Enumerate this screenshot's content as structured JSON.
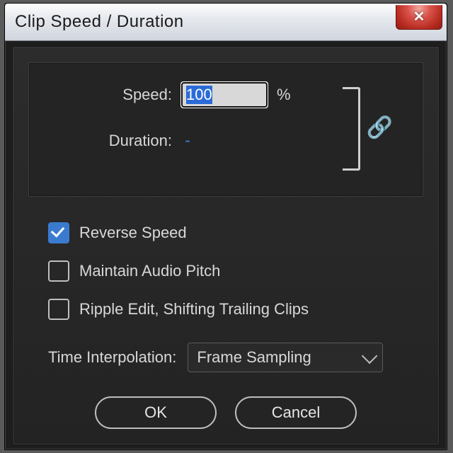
{
  "window": {
    "title": "Clip Speed / Duration"
  },
  "fields": {
    "speed_label": "Speed:",
    "speed_value": "100",
    "speed_unit": "%",
    "duration_label": "Duration:",
    "duration_value": "-"
  },
  "link": {
    "tooltip": "Link speed and duration"
  },
  "checks": {
    "reverse": {
      "label": "Reverse Speed",
      "checked": true
    },
    "pitch": {
      "label": "Maintain Audio Pitch",
      "checked": false
    },
    "ripple": {
      "label": "Ripple Edit, Shifting Trailing Clips",
      "checked": false
    }
  },
  "time_interpolation": {
    "label": "Time Interpolation:",
    "value": "Frame Sampling"
  },
  "buttons": {
    "ok": "OK",
    "cancel": "Cancel"
  }
}
